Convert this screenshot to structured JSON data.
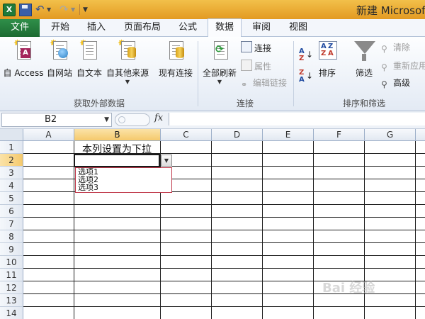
{
  "window": {
    "title": "新建 Microsoft Excel 工作表.xlsx - Microsoft Excel",
    "title_visible": "新建 Microsoft"
  },
  "quick_access": {
    "logo": "X"
  },
  "tabs": [
    {
      "label": "文件"
    },
    {
      "label": "开始"
    },
    {
      "label": "插入"
    },
    {
      "label": "页面布局"
    },
    {
      "label": "公式"
    },
    {
      "label": "数据"
    },
    {
      "label": "审阅"
    },
    {
      "label": "视图"
    }
  ],
  "ribbon": {
    "group_external": {
      "label": "获取外部数据",
      "btn_access": "自 Access",
      "btn_web": "自网站",
      "btn_text": "自文本",
      "btn_other": "自其他来源",
      "access_badge": "A"
    },
    "btn_existing": "现有连接",
    "group_connections": {
      "label": "连接",
      "btn_refresh": "全部刷新",
      "btn_conn": "连接",
      "btn_props": "属性",
      "btn_editlinks": "编辑链接"
    },
    "group_sort": {
      "label": "排序和筛选",
      "btn_sort": "排序",
      "btn_filter": "筛选",
      "btn_clear": "清除",
      "btn_reapply": "重新应用",
      "btn_advanced": "高级",
      "az_a": "A",
      "az_z": "Z"
    }
  },
  "formula_bar": {
    "name_box": "B2",
    "fx": "fx",
    "value": ""
  },
  "grid": {
    "columns": [
      "A",
      "B",
      "C",
      "D",
      "E",
      "F",
      "G"
    ],
    "rows": [
      "1",
      "2",
      "3",
      "4",
      "5",
      "6",
      "7",
      "8",
      "9",
      "10",
      "11",
      "12",
      "13",
      "14"
    ],
    "b1": "本列设置为下拉",
    "selected_column": "B",
    "selected_row": "2"
  },
  "dropdown": {
    "options": [
      "选项1",
      "选项2",
      "选项3"
    ]
  },
  "watermark": "Bai 经验",
  "colors": {
    "file_tab": "#1f7a3a",
    "title_bar": "#e8a830",
    "selection_header": "#f5c96c",
    "dropdown_border": "#c0394b"
  }
}
